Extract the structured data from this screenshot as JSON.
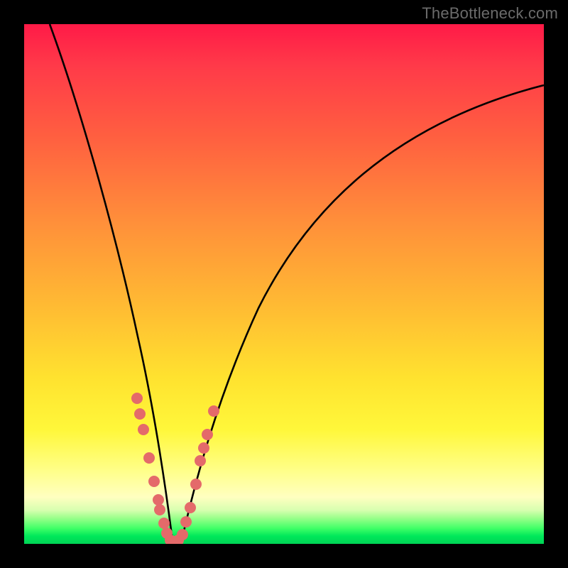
{
  "watermark": "TheBottleneck.com",
  "colors": {
    "frame": "#000000",
    "gradient_top": "#ff1a47",
    "gradient_mid": "#ffe22f",
    "gradient_bottom": "#00d455",
    "curve": "#000000",
    "dots": "#e46a6a"
  },
  "chart_data": {
    "type": "line",
    "title": "",
    "xlabel": "",
    "ylabel": "",
    "xlim": [
      0,
      100
    ],
    "ylim": [
      0,
      100
    ],
    "annotations": [
      "TheBottleneck.com"
    ],
    "series": [
      {
        "name": "bottleneck-curve",
        "x": [
          5,
          8,
          11,
          14,
          17,
          20,
          22,
          24,
          25.5,
          27,
          28.5,
          30,
          32,
          35,
          40,
          46,
          54,
          63,
          73,
          84,
          95,
          100
        ],
        "y": [
          100,
          88,
          75,
          62,
          48,
          35,
          25,
          16,
          9,
          3,
          0.5,
          2,
          8,
          18,
          32,
          45,
          57,
          67,
          75,
          81,
          86,
          88
        ]
      }
    ],
    "scatter_overlay": {
      "name": "curve-dots",
      "points": [
        {
          "x": 21.7,
          "y": 28
        },
        {
          "x": 22.3,
          "y": 25
        },
        {
          "x": 22.9,
          "y": 22
        },
        {
          "x": 24.0,
          "y": 16.5
        },
        {
          "x": 25.0,
          "y": 12
        },
        {
          "x": 25.8,
          "y": 8.5
        },
        {
          "x": 26.1,
          "y": 6.5
        },
        {
          "x": 26.9,
          "y": 4.0
        },
        {
          "x": 27.5,
          "y": 2.0
        },
        {
          "x": 28.1,
          "y": 0.7
        },
        {
          "x": 28.9,
          "y": 0.4
        },
        {
          "x": 29.6,
          "y": 0.7
        },
        {
          "x": 30.4,
          "y": 1.8
        },
        {
          "x": 31.2,
          "y": 4.2
        },
        {
          "x": 32.0,
          "y": 7.0
        },
        {
          "x": 33.0,
          "y": 11.5
        },
        {
          "x": 33.9,
          "y": 16.0
        },
        {
          "x": 34.6,
          "y": 18.5
        },
        {
          "x": 35.2,
          "y": 21.0
        },
        {
          "x": 36.5,
          "y": 25.5
        }
      ]
    }
  }
}
